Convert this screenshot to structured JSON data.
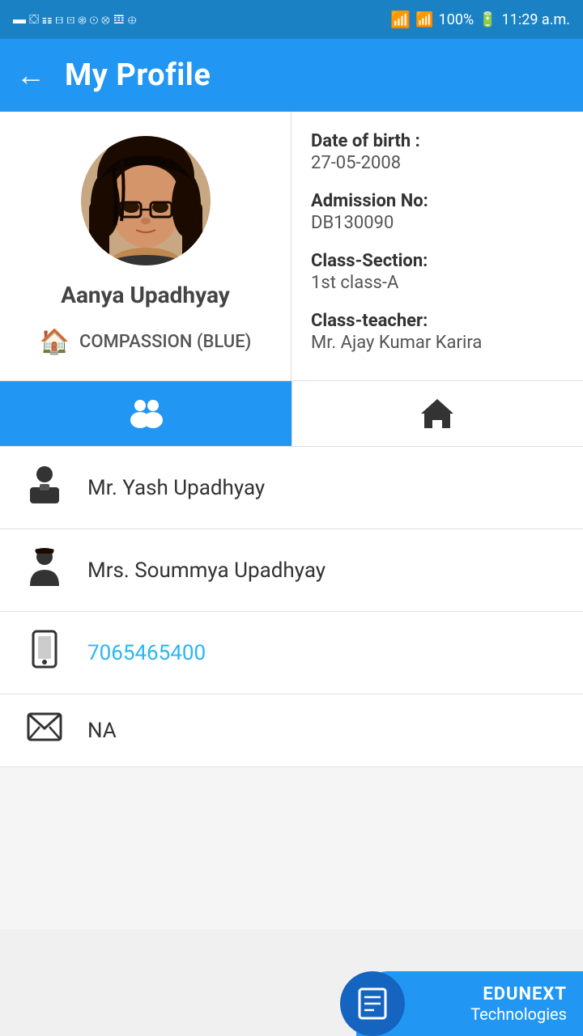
{
  "statusBar": {
    "time": "11:29 a.m.",
    "battery": "100%"
  },
  "header": {
    "title": "My Profile",
    "backLabel": "←"
  },
  "profile": {
    "name": "Aanya Upadhyay",
    "house": "COMPASSION (BLUE)",
    "dob_label": "Date of birth :",
    "dob_value": "27-05-2008",
    "admission_label": "Admission No:",
    "admission_value": "DB130090",
    "class_label": "Class-Section:",
    "class_value": "1st class-A",
    "teacher_label": "Class-teacher:",
    "teacher_value": "Mr. Ajay Kumar Karira"
  },
  "tabs": [
    {
      "id": "family",
      "icon": "👥",
      "active": true
    },
    {
      "id": "home",
      "icon": "🏠",
      "active": false
    }
  ],
  "contacts": [
    {
      "type": "father",
      "icon": "👨‍💼",
      "name": "Mr. Yash  Upadhyay"
    },
    {
      "type": "mother",
      "icon": "👩",
      "name": "Mrs. Soummya  Upadhyay"
    },
    {
      "type": "phone",
      "icon": "📞",
      "value": "7065465400",
      "isPhone": true
    },
    {
      "type": "email",
      "icon": "✉",
      "value": "NA",
      "isPhone": false
    }
  ],
  "brand": {
    "top": "EDUNEXT",
    "bottom": "Technologies",
    "icon": "📖"
  }
}
